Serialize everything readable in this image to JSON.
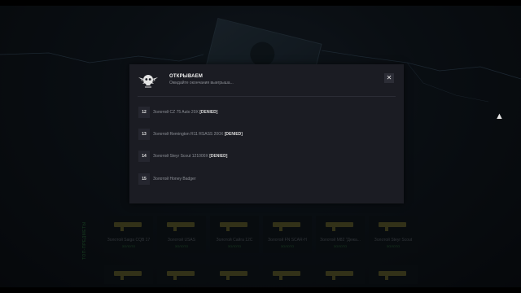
{
  "modal": {
    "title": "ОТКРЫВАЕМ",
    "subtitle": "Ожидайте окончания выигрыша...",
    "close_label": "✕",
    "rewards": [
      {
        "num": "12",
        "name": "Золотой CZ 75 Auto 20X",
        "tag": "[DENIED]"
      },
      {
        "num": "13",
        "name": "Золотой Remington R11 RSASS 200X",
        "tag": "[DENIED]"
      },
      {
        "num": "14",
        "name": "Золотой Steyr Scout 121000X",
        "tag": "[DENIED]"
      },
      {
        "num": "15",
        "name": "Золотой Honey Badger",
        "tag": ""
      }
    ]
  },
  "background": {
    "side_label": "ТОП-ПРЕДМЕТЫ",
    "weapons": [
      {
        "name": "Золотой Saiga CQB 17",
        "tag": "ЗОЛОТО"
      },
      {
        "name": "Золотой USAS",
        "tag": "ЗОЛОТО"
      },
      {
        "name": "Золотой Сайга 12С",
        "tag": "ЗОЛОТО"
      },
      {
        "name": "Золотой FN SCAR-H",
        "tag": "ЗОЛОТО"
      },
      {
        "name": "Золотой M82 \"Дежа...",
        "tag": "ЗОЛОТО"
      },
      {
        "name": "Золотой Steyr Scout",
        "tag": "ЗОЛОТО"
      }
    ]
  },
  "colors": {
    "modal_bg": "#1b1c23",
    "accent_green": "#2d6b3c",
    "gold_weapon": "#5b5a2c"
  },
  "icons": {
    "emblem": "winged-skull-emblem-icon",
    "close": "close-icon",
    "cursor": "mouse-cursor-icon"
  }
}
